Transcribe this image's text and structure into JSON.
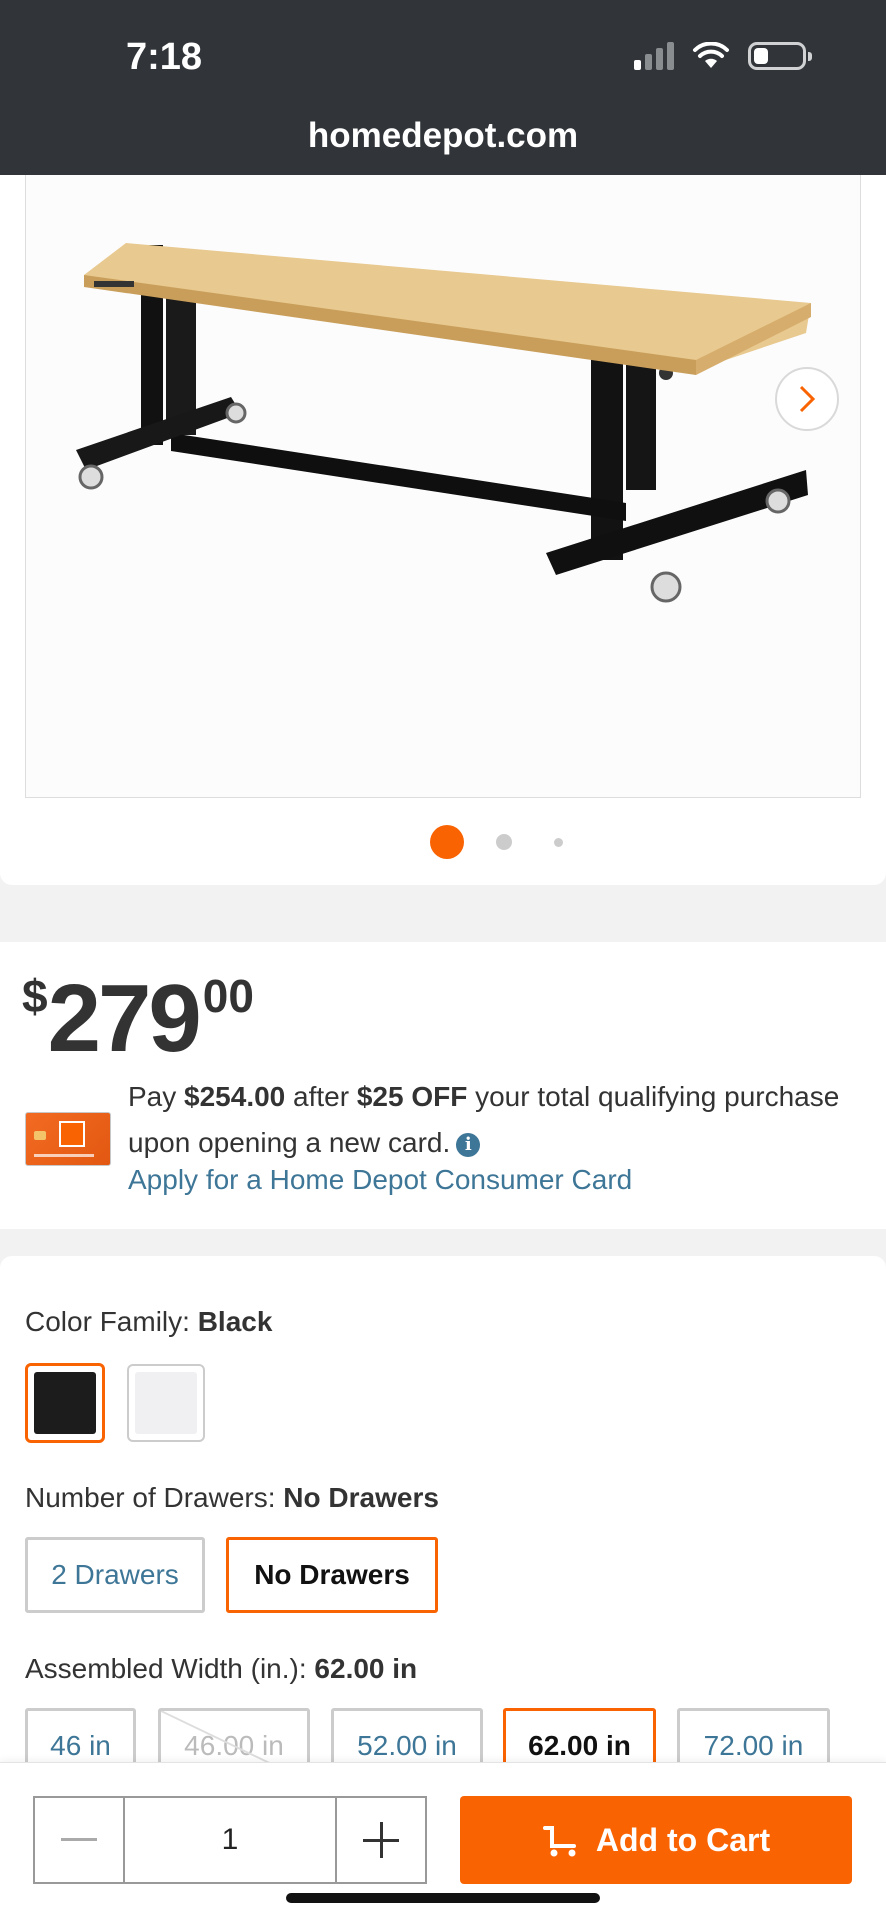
{
  "status_bar": {
    "time": "7:18"
  },
  "browser": {
    "url": "homedepot.com"
  },
  "gallery": {
    "image_alt": "Adjustable height workbench with wood top and black steel legs",
    "page_count": 3,
    "active_index": 0
  },
  "price": {
    "currency": "$",
    "dollars": "279",
    "cents": "00"
  },
  "offer": {
    "text_1": "Pay ",
    "price_after": "$254.00",
    "text_2": " after ",
    "discount": "$25 OFF",
    "text_3": " your total qualifying purchase upon opening a new card.",
    "link": "Apply for a Home Depot Consumer Card"
  },
  "color_family": {
    "label": "Color Family: ",
    "selected": "Black",
    "swatches": [
      {
        "color": "#1c1c1c"
      },
      {
        "color": "#f0f0f2"
      }
    ]
  },
  "drawers": {
    "label": "Number of Drawers: ",
    "selected": "No Drawers",
    "options": [
      "2 Drawers",
      "No Drawers"
    ]
  },
  "width": {
    "label": "Assembled Width (in.): ",
    "selected": "62.00 in",
    "options": [
      "46 in",
      "46.00 in",
      "52.00 in",
      "62.00 in",
      "72.00 in"
    ]
  },
  "cart": {
    "quantity": "1",
    "add_label": "Add to Cart"
  },
  "colors": {
    "accent": "#f96302",
    "link": "#3e7697",
    "topbar": "#313539"
  }
}
